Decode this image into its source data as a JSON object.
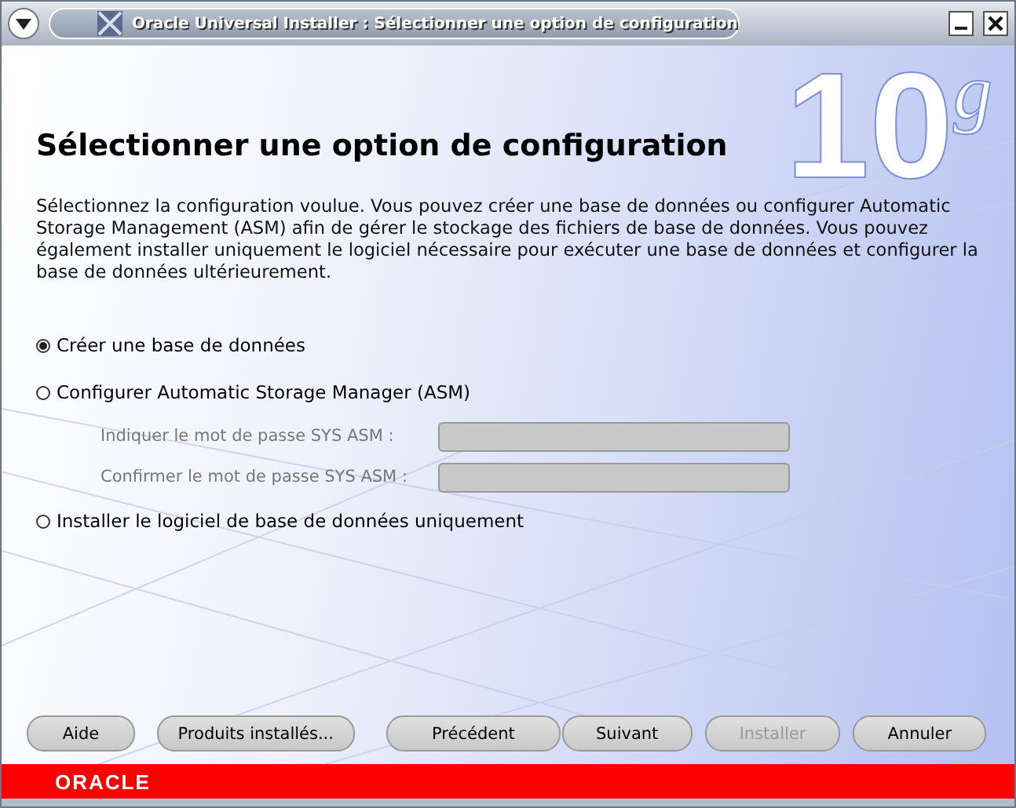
{
  "window": {
    "title": "Oracle Universal Installer : Sélectionner une option de configuration"
  },
  "logo": {
    "number": "10",
    "letter": "g"
  },
  "heading": "Sélectionner une option de configuration",
  "description": "Sélectionnez la configuration voulue. Vous pouvez créer une base de données ou configurer Automatic Storage Management (ASM) afin de gérer le stockage des fichiers de base de données. Vous pouvez également installer uniquement le logiciel nécessaire pour exécuter une base de données et configurer la base de données ultérieurement.",
  "options": [
    {
      "label": "Créer une base de données",
      "selected": true
    },
    {
      "label": "Configurer Automatic Storage Manager (ASM)",
      "selected": false,
      "fields": [
        {
          "label": "Indiquer le mot de passe SYS ASM :",
          "disabled": true
        },
        {
          "label": "Confirmer le mot de passe SYS ASM :",
          "disabled": true
        }
      ]
    },
    {
      "label": "Installer le logiciel de base de données uniquement",
      "selected": false
    }
  ],
  "buttons": [
    {
      "label": "Aide",
      "disabled": false
    },
    {
      "label": "Produits installés...",
      "disabled": false
    },
    {
      "label": "Précédent",
      "disabled": false
    },
    {
      "label": "Suivant",
      "disabled": false
    },
    {
      "label": "Installer",
      "disabled": true
    },
    {
      "label": "Annuler",
      "disabled": false
    }
  ],
  "footer": {
    "brand": "ORACLE"
  }
}
